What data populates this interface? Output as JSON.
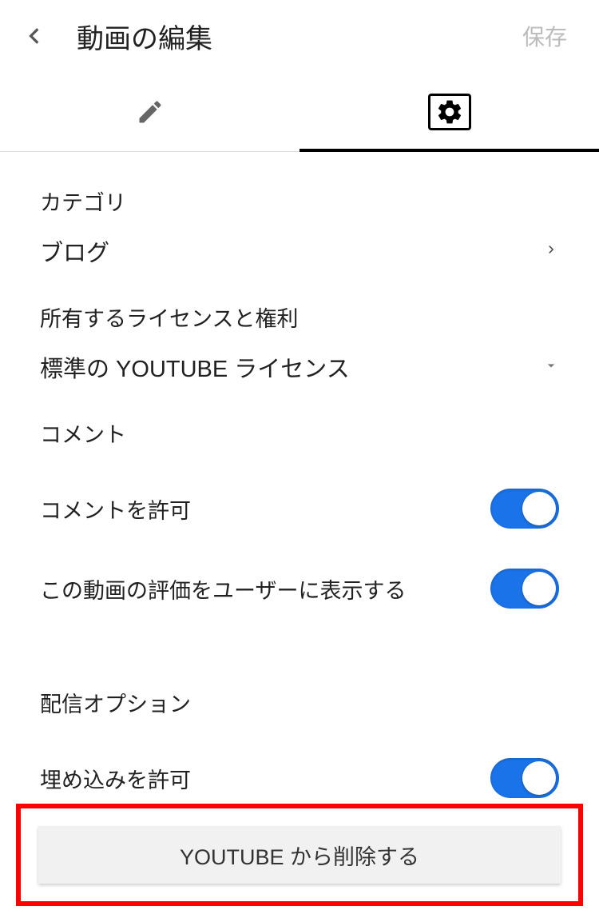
{
  "header": {
    "title": "動画の編集",
    "save_label": "保存"
  },
  "category": {
    "label": "カテゴリ",
    "value": "ブログ"
  },
  "license": {
    "label": "所有するライセンスと権利",
    "value": "標準の YOUTUBE ライセンス"
  },
  "comments": {
    "section_title": "コメント",
    "allow_label": "コメントを許可",
    "show_ratings_label": "この動画の評価をユーザーに表示する"
  },
  "distribution": {
    "section_title": "配信オプション",
    "embed_label": "埋め込みを許可"
  },
  "delete": {
    "button_label": "YOUTUBE から削除する"
  }
}
